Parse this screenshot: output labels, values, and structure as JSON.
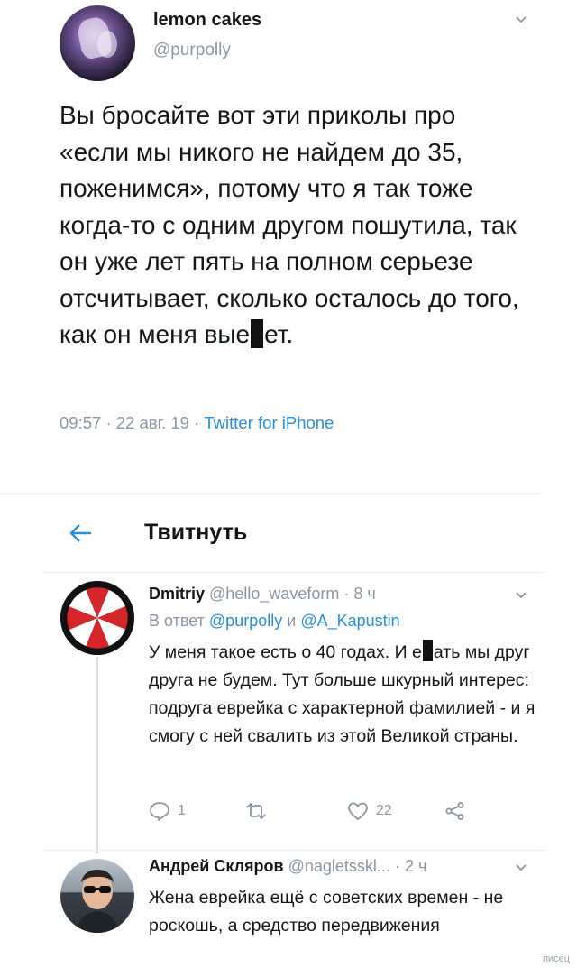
{
  "main_tweet": {
    "name": "lemon cakes",
    "handle": "@purpolly",
    "text_part1": "Вы бросайте вот эти приколы про «если мы никого не найдем до 35, поженимся», потому что я так тоже когда-то с одним другом пошутила, так он уже лет пять на полном серьезе отсчитывает, сколько осталось до того, как он меня вые",
    "text_part2": "ет.",
    "time": "09:57",
    "date": "22 авг. 19",
    "source": "Twitter for iPhone"
  },
  "header": {
    "back_icon": "arrow-left-icon",
    "title": "Твитнуть"
  },
  "replies": [
    {
      "name": "Dmitriy",
      "handle": "@hello_waveform",
      "time": "8 ч",
      "reply_prefix": "В ответ",
      "reply_to_1": "@purpolly",
      "reply_and": "и",
      "reply_to_2": "@A_Kapustin",
      "text_part1": "У меня такое есть о 40 годах. И е",
      "text_part2": "ать мы друг друга не будем. Тут больше шкурный интерес: подруга еврейка с характерной фамилией - и я смогу с ней свалить из этой Великой страны.",
      "actions": {
        "reply_count": "1",
        "retweet_count": "",
        "like_count": "22"
      }
    },
    {
      "name": "Андрей Скляров",
      "handle": "@nagletsskl...",
      "time": "2 ч",
      "text": "Жена еврейка ещё с советских времен - не роскошь, а средство передвижения"
    }
  ],
  "watermark": "писец",
  "colors": {
    "link": "#2a8dd8",
    "muted": "#8a96a3",
    "text": "#14171a"
  }
}
